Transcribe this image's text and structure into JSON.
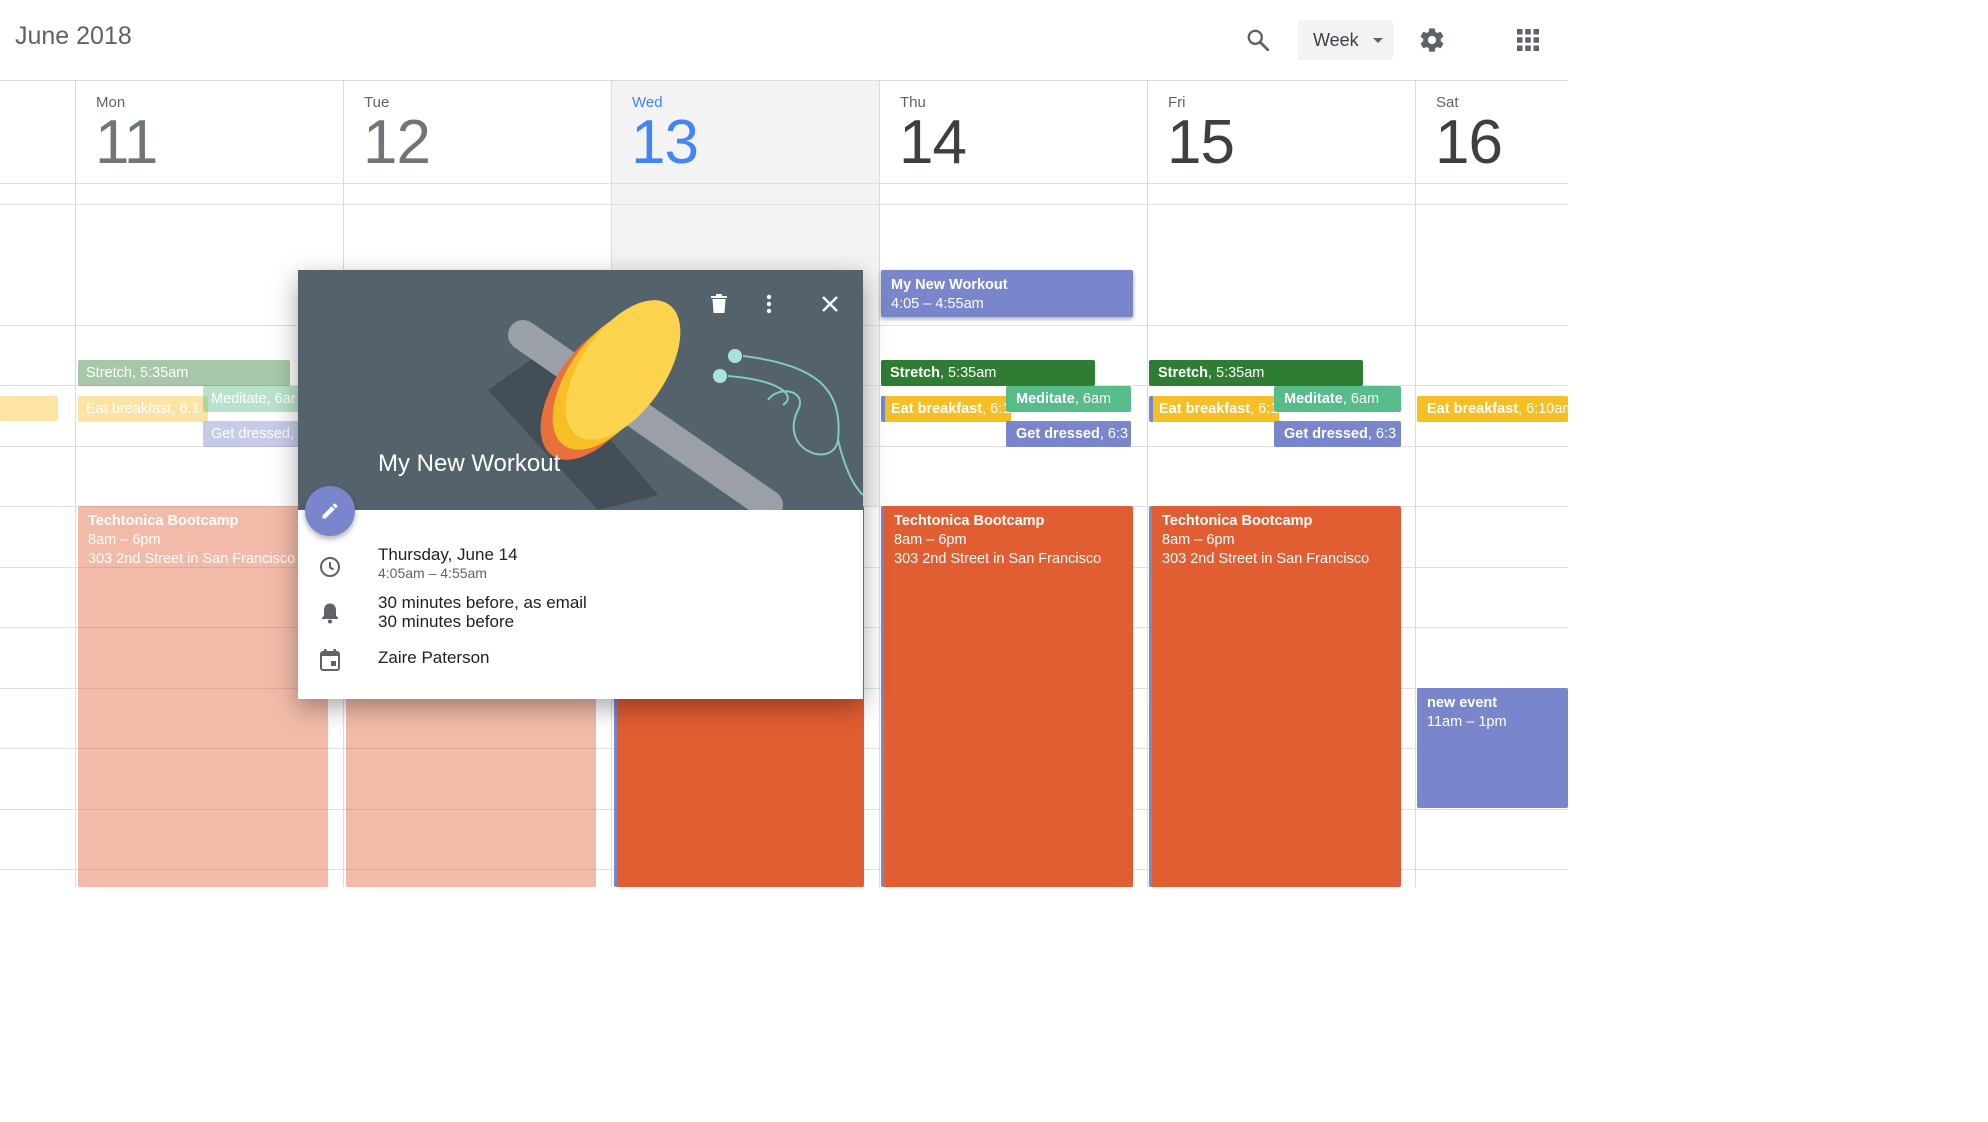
{
  "header": {
    "month_title": "June 2018",
    "view_label": "Week",
    "icons": [
      "search-icon",
      "chevron-down-icon",
      "gear-icon",
      "apps-grid-icon"
    ]
  },
  "days": [
    {
      "name": "Mon",
      "num": "11"
    },
    {
      "name": "Tue",
      "num": "12"
    },
    {
      "name": "Wed",
      "num": "13",
      "today": true
    },
    {
      "name": "Thu",
      "num": "14"
    },
    {
      "name": "Fri",
      "num": "15"
    },
    {
      "name": "Sat",
      "num": "16"
    }
  ],
  "events": {
    "workout": {
      "title": "My New Workout",
      "time": "4:05 – 4:55am"
    },
    "stretch": {
      "title": "Stretch",
      "time": ", 5:35am"
    },
    "meditate": {
      "title": "Meditate",
      "time": ", 6am"
    },
    "meditate_mon": {
      "title": "Meditate",
      "time": ", 6ar"
    },
    "breakfast_mon": {
      "title": "Eat breakfast",
      "time": ", 6:1"
    },
    "breakfast_thu": {
      "title": "Eat breakfast",
      "time": ", 6:1"
    },
    "breakfast_fri": {
      "title": "Eat breakfast",
      "time": ", 6:1"
    },
    "breakfast_sat": {
      "title": "Eat breakfast",
      "time": ", 6:10am"
    },
    "dressed_mon": {
      "title": "Get dressed",
      "time": ","
    },
    "dressed": {
      "title": "Get dressed",
      "time": ", 6:3"
    },
    "bootcamp": {
      "title": "Techtonica Bootcamp",
      "time": "8am – 6pm",
      "location": "303 2nd Street in San Francisco"
    },
    "new_event": {
      "title": "new event",
      "time": "11am – 1pm"
    }
  },
  "popup": {
    "title": "My New Workout",
    "date": "Thursday, June 14",
    "time": "4:05am – 4:55am",
    "reminder_1": "30 minutes before, as email",
    "reminder_2": "30 minutes before",
    "calendar": "Zaire Paterson",
    "icons": [
      "delete-icon",
      "more-vert-icon",
      "close-icon",
      "edit-icon",
      "clock-icon",
      "bell-icon",
      "calendar-icon"
    ]
  },
  "colors": {
    "lavender": "#7986cb",
    "dark_green": "#2e7d32",
    "mint": "#57bb8a",
    "yellow": "#f6bf26",
    "tangerine": "#e15d32",
    "today_blue": "#4285f4",
    "hero_bg": "#54626c"
  }
}
